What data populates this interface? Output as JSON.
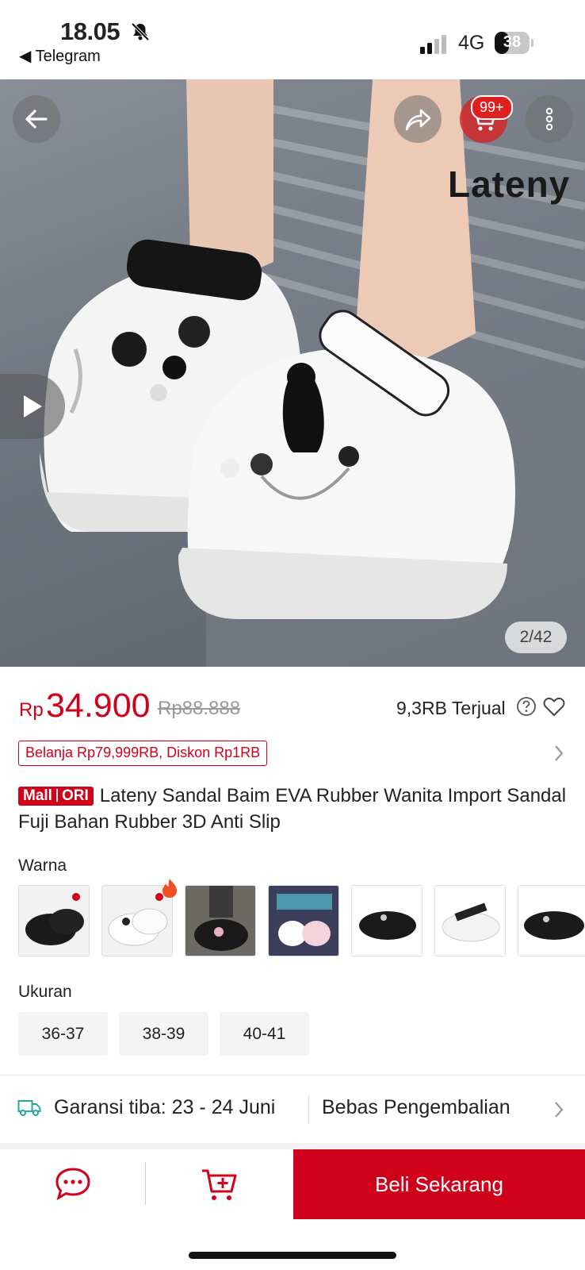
{
  "status_bar": {
    "time": "18.05",
    "back_app": "◀ Telegram",
    "network": "4G",
    "battery": "38"
  },
  "gallery": {
    "counter": "2/42",
    "cart_badge": "99+",
    "brand_watermark": "Lateny"
  },
  "price": {
    "currency": "Rp",
    "current": "34.900",
    "original": "Rp88.888",
    "sold": "9,3RB Terjual"
  },
  "promo": {
    "label": "Belanja Rp79,999RB, Diskon Rp1RB"
  },
  "product": {
    "badge_mall": "Mall",
    "badge_ori": "ORI",
    "title": "Lateny Sandal Baim EVA Rubber Wanita Import Sandal Fuji Bahan Rubber 3D Anti Slip"
  },
  "variants": {
    "color_label": "Warna",
    "colors": [
      "black-logo",
      "white-logo",
      "black-lifestyle",
      "white-pink-display",
      "black",
      "white",
      "black-partial"
    ],
    "size_label": "Ukuran",
    "sizes": [
      "36-37",
      "38-39",
      "40-41"
    ]
  },
  "shipping": {
    "delivery": "Garansi tiba: 23 - 24 Juni",
    "returns": "Bebas Pengembalian"
  },
  "bottom_bar": {
    "buy_label": "Beli Sekarang"
  },
  "colors": {
    "accent": "#d0011b",
    "shipping_icon": "#26aa99"
  }
}
